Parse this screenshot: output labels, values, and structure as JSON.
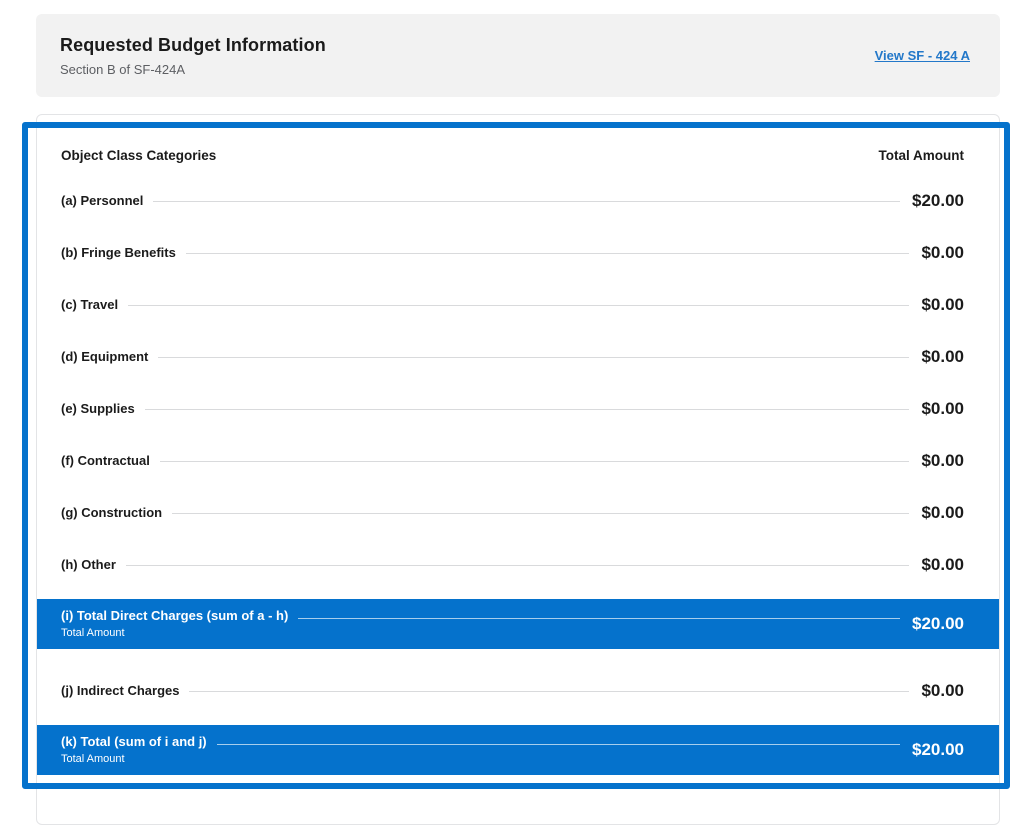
{
  "header": {
    "title": "Requested Budget Information",
    "subtitle": "Section B of SF-424A",
    "link_label": "View SF - 424 A"
  },
  "table": {
    "col_category": "Object Class Categories",
    "col_amount": "Total Amount",
    "rows": [
      {
        "label": "(a) Personnel",
        "amount": "$20.00",
        "highlight": false
      },
      {
        "label": "(b) Fringe Benefits",
        "amount": "$0.00",
        "highlight": false
      },
      {
        "label": "(c) Travel",
        "amount": "$0.00",
        "highlight": false
      },
      {
        "label": "(d) Equipment",
        "amount": "$0.00",
        "highlight": false
      },
      {
        "label": "(e) Supplies",
        "amount": "$0.00",
        "highlight": false
      },
      {
        "label": "(f) Contractual",
        "amount": "$0.00",
        "highlight": false
      },
      {
        "label": "(g) Construction",
        "amount": "$0.00",
        "highlight": false
      },
      {
        "label": "(h) Other",
        "amount": "$0.00",
        "highlight": false
      },
      {
        "label": "(i) Total Direct Charges (sum of a - h)",
        "sublabel": "Total Amount",
        "amount": "$20.00",
        "highlight": true
      },
      {
        "label": "(j) Indirect Charges",
        "amount": "$0.00",
        "highlight": false
      },
      {
        "label": "(k) Total (sum of i and j)",
        "sublabel": "Total Amount",
        "amount": "$20.00",
        "highlight": true
      }
    ]
  },
  "colors": {
    "accent_blue": "#0572cc",
    "link_blue": "#2378c9",
    "header_card_bg": "#f2f2f2",
    "text": "#1b1b1b",
    "subtitle_gray": "#5d5f63",
    "leader_line": "#d9dadc",
    "card_border": "#e3e4e6"
  }
}
